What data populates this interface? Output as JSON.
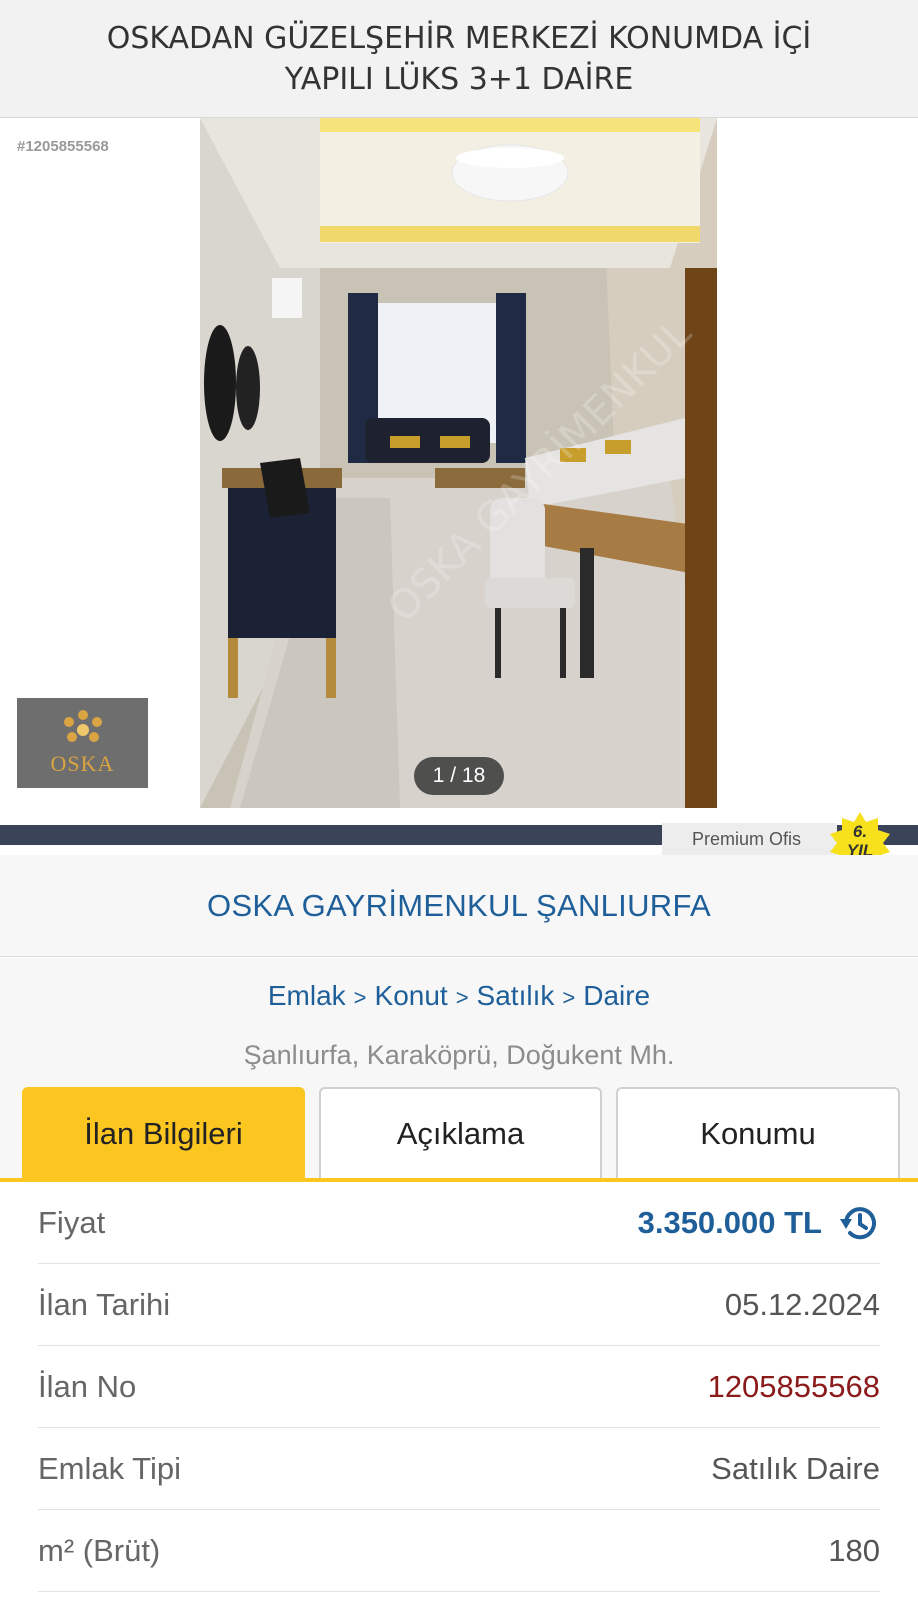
{
  "header": {
    "title": "OSKADAN GÜZELŞEHİR MERKEZİ KONUMDA İÇİ YAPILI LÜKS 3+1 DAİRE"
  },
  "gallery": {
    "listing_id": "#1205855568",
    "logo_text": "OSKA",
    "counter": "1 / 18"
  },
  "office": {
    "badge_label": "Premium Ofis",
    "years": "6.",
    "years_unit": "YIL",
    "name": "OSKA GAYRİMENKUL ŞANLIURFA"
  },
  "breadcrumb": [
    "Emlak",
    "Konut",
    "Satılık",
    "Daire"
  ],
  "location": "Şanlıurfa, Karaköprü, Doğukent Mh.",
  "tabs": [
    {
      "label": "İlan Bilgileri",
      "active": true
    },
    {
      "label": "Açıklama",
      "active": false
    },
    {
      "label": "Konumu",
      "active": false
    }
  ],
  "details": [
    {
      "key": "Fiyat",
      "value": "3.350.000 TL"
    },
    {
      "key": "İlan Tarihi",
      "value": "05.12.2024"
    },
    {
      "key": "İlan No",
      "value": "1205855568"
    },
    {
      "key": "Emlak Tipi",
      "value": "Satılık Daire"
    },
    {
      "key": "m² (Brüt)",
      "value": "180"
    }
  ],
  "colors": {
    "accent_yellow": "#fcc621",
    "link_blue": "#1f5f99",
    "dark_bar": "#3b4359",
    "id_red": "#8b1a1a"
  },
  "icons": {
    "price_history": "history-icon",
    "logo": "oska-logo-icon"
  }
}
